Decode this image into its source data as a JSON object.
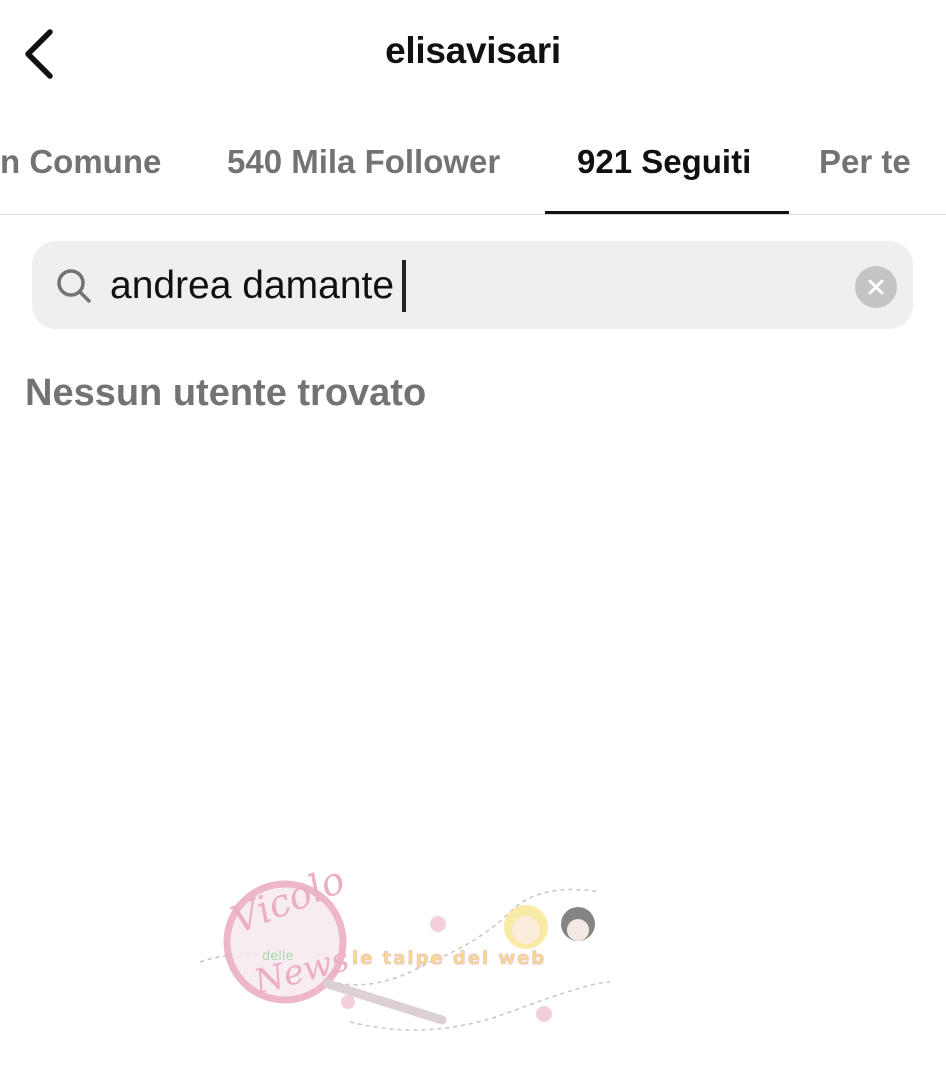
{
  "header": {
    "title": "elisavisari",
    "back_icon": "chevron-left-icon"
  },
  "tabs": [
    {
      "label": "n Comune",
      "active": false
    },
    {
      "label": "540 Mila Follower",
      "active": false
    },
    {
      "label": "921 Seguiti",
      "active": true
    },
    {
      "label": "Per te",
      "active": false
    }
  ],
  "search": {
    "value": "andrea damante",
    "icon": "search-icon",
    "clear_icon": "clear-circle-icon"
  },
  "results": {
    "empty_message": "Nessun utente trovato"
  },
  "watermark": {
    "logo_text": [
      "Vicolo",
      "delle",
      "News"
    ],
    "tagline": "le talpe del web"
  },
  "colors": {
    "background": "#ffffff",
    "text_primary": "#111111",
    "text_secondary": "#737373",
    "search_bg": "#efefef",
    "watermark_pink": "#e8a0bc",
    "watermark_yellow": "#f5d76e"
  }
}
